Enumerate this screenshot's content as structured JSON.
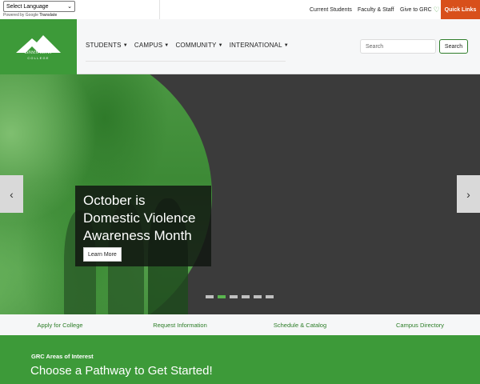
{
  "topbar": {
    "language_select": "Select Language",
    "powered_by": "Powered by",
    "google": "Google",
    "translate": "Translate",
    "links": [
      "Current Students",
      "Faculty & Staff",
      "Give to GRC"
    ],
    "quick_links": "Quick Links"
  },
  "brand": {
    "name": "Green River",
    "sub": "COLLEGE",
    "color": "#3d9a39",
    "accent": "#d8501b"
  },
  "nav": {
    "menu": [
      "STUDENTS",
      "CAMPUS",
      "COMMUNITY",
      "INTERNATIONAL"
    ],
    "search_placeholder": "Search",
    "search_button": "Search"
  },
  "carousel": {
    "title_lines": [
      "October is",
      "Domestic Violence",
      "Awareness Month"
    ],
    "button": "Learn More",
    "prev": "‹",
    "next": "›",
    "slide_count": 6,
    "active_slide": 2
  },
  "quicklinks": [
    "Apply for College",
    "Request Information",
    "Schedule & Catalog",
    "Campus Directory"
  ],
  "pathway": {
    "kicker": "GRC Areas of Interest",
    "heading": "Choose a Pathway to Get Started!"
  }
}
